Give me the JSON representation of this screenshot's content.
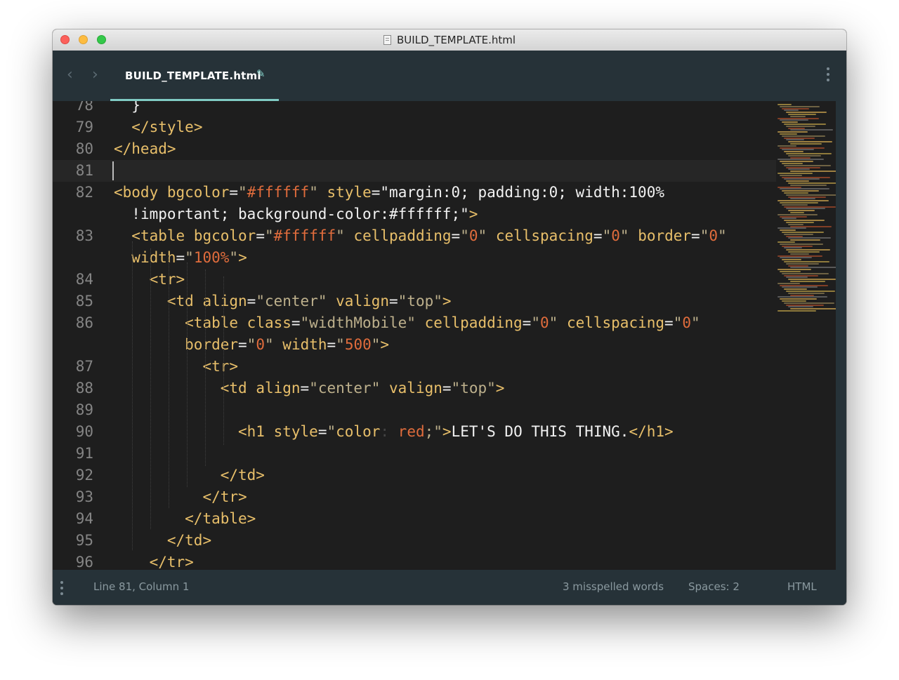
{
  "window": {
    "title": "BUILD_TEMPLATE.html"
  },
  "tabbar": {
    "back_icon": "chevron-left-icon",
    "forward_icon": "chevron-right-icon",
    "active_tab": "BUILD_TEMPLATE.html",
    "edit_icon": "pencil-icon",
    "menu_icon": "vertical-dots-icon",
    "accent_color": "#80cbc4"
  },
  "editor": {
    "current_line": 81,
    "lines": [
      {
        "num": "78",
        "code": "  }"
      },
      {
        "num": "79",
        "code": "  </style>"
      },
      {
        "num": "80",
        "code": "</head>"
      },
      {
        "num": "81",
        "code": ""
      },
      {
        "num": "82",
        "code": "<body bgcolor=\"#ffffff\" style=\"margin:0; padding:0; width:100%"
      },
      {
        "num": "",
        "code": "  !important; background-color:#ffffff;\">"
      },
      {
        "num": "83",
        "code": "  <table bgcolor=\"#ffffff\" cellpadding=\"0\" cellspacing=\"0\" border=\"0\""
      },
      {
        "num": "",
        "code": "  width=\"100%\">"
      },
      {
        "num": "84",
        "code": "    <tr>"
      },
      {
        "num": "85",
        "code": "      <td align=\"center\" valign=\"top\">"
      },
      {
        "num": "86",
        "code": "        <table class=\"widthMobile\" cellpadding=\"0\" cellspacing=\"0\""
      },
      {
        "num": "",
        "code": "        border=\"0\" width=\"500\">"
      },
      {
        "num": "87",
        "code": "          <tr>"
      },
      {
        "num": "88",
        "code": "            <td align=\"center\" valign=\"top\">"
      },
      {
        "num": "89",
        "code": ""
      },
      {
        "num": "90",
        "code": "              <h1 style=\"color: red;\">LET'S DO THIS THING.</h1>"
      },
      {
        "num": "91",
        "code": ""
      },
      {
        "num": "92",
        "code": "            </td>"
      },
      {
        "num": "93",
        "code": "          </tr>"
      },
      {
        "num": "94",
        "code": "        </table>"
      },
      {
        "num": "95",
        "code": "      </td>"
      },
      {
        "num": "96",
        "code": "    </tr>"
      }
    ]
  },
  "statusbar": {
    "menu_icon": "vertical-dots-icon",
    "position": "Line 81, Column 1",
    "spelling": "3 misspelled words",
    "indentation": "Spaces: 2",
    "syntax": "HTML"
  }
}
